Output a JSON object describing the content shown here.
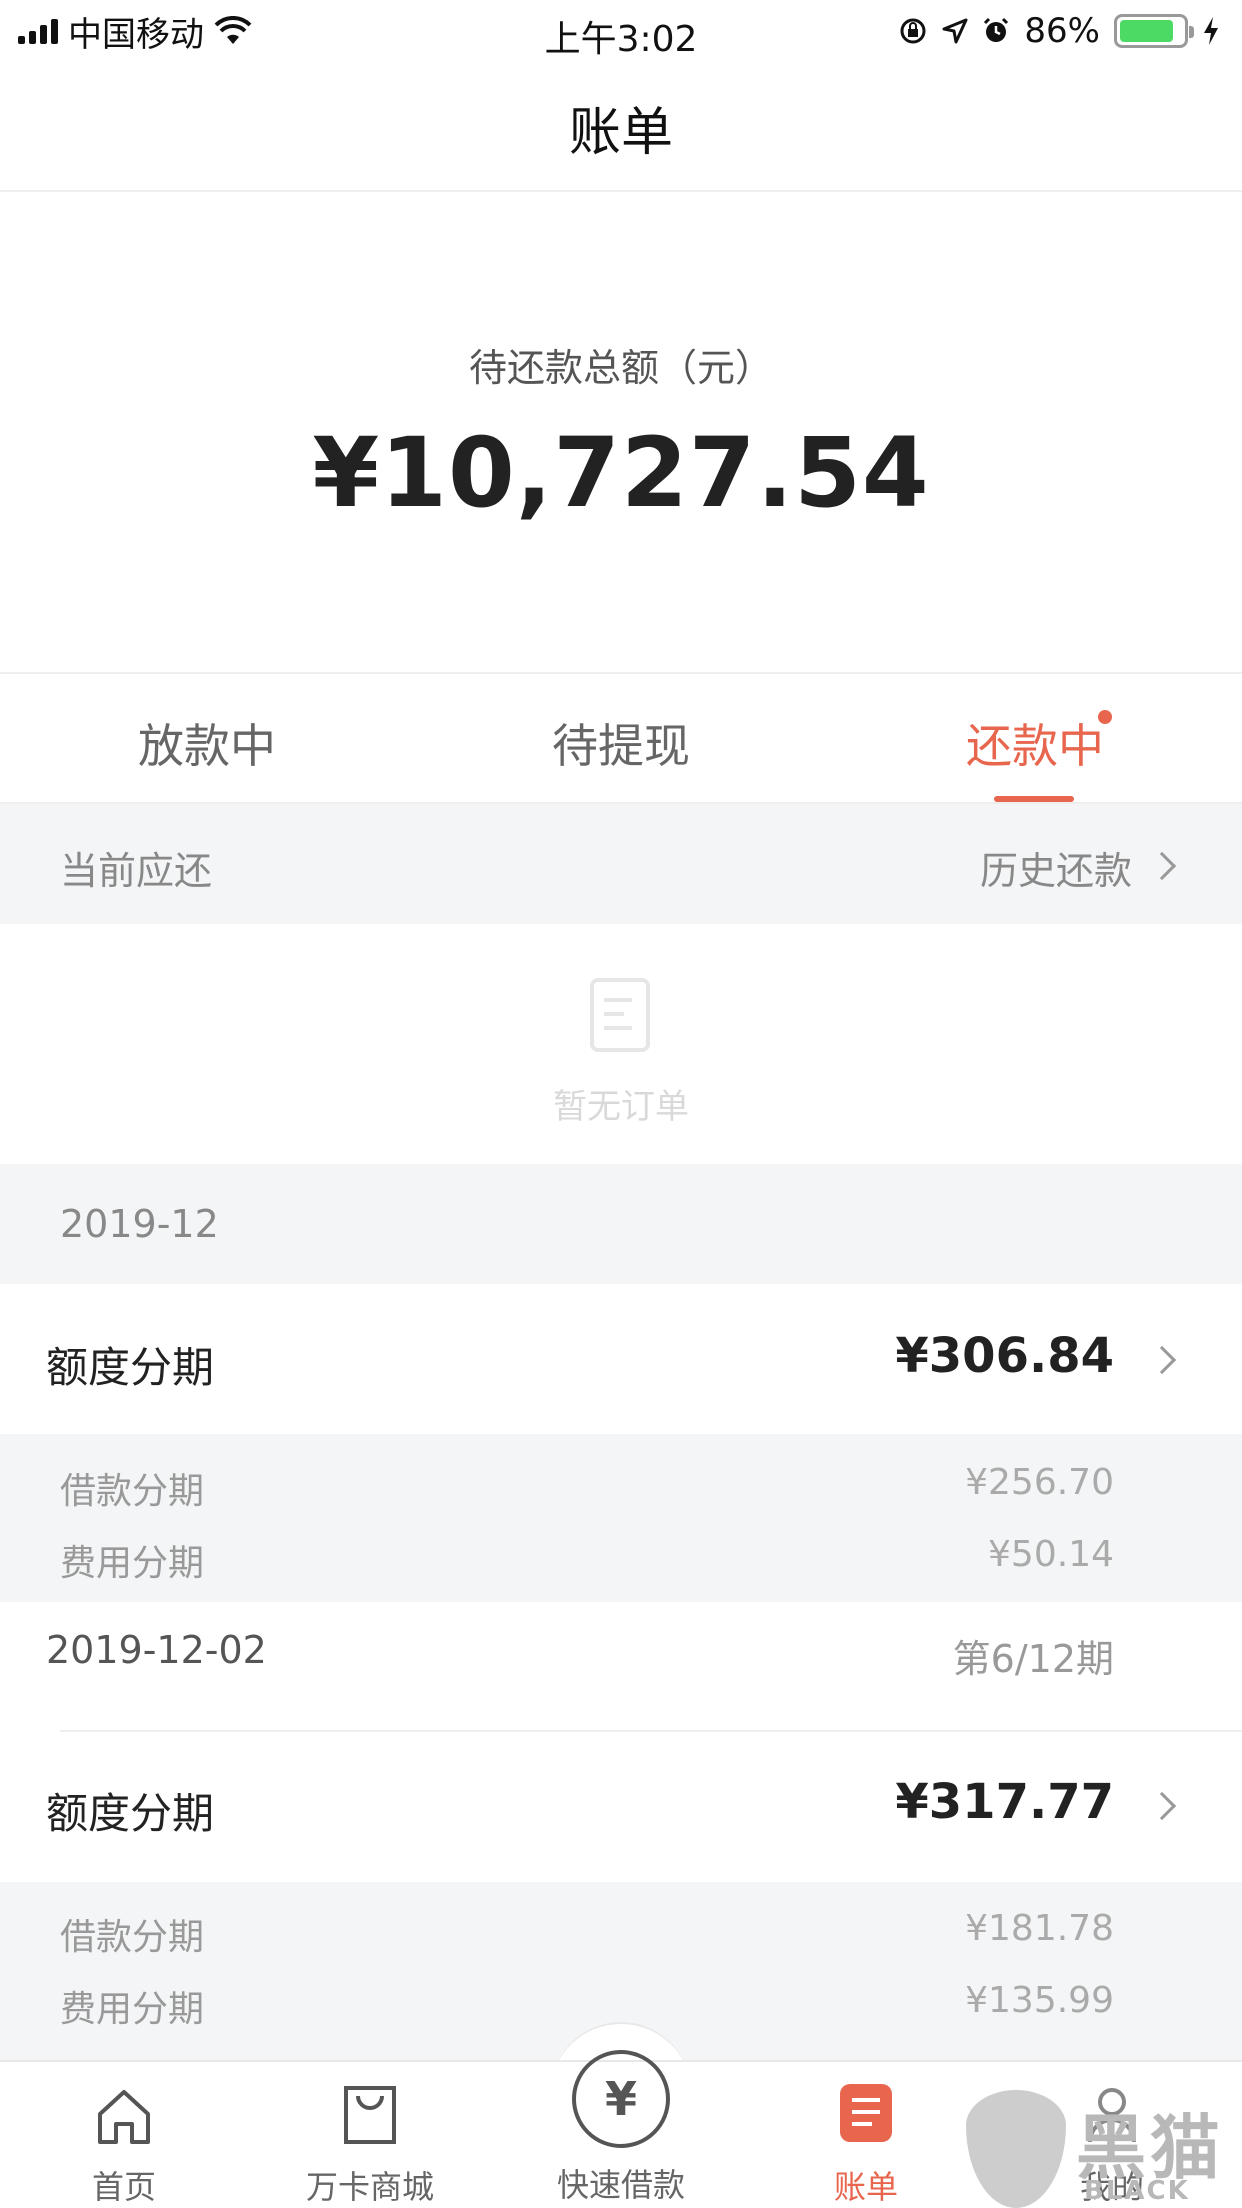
{
  "status_bar": {
    "carrier": "中国移动",
    "time": "上午3:02",
    "battery_percent": "86%",
    "battery_level": 0.86,
    "icons": [
      "signal-icon",
      "wifi-icon",
      "orientation-lock-icon",
      "location-icon",
      "alarm-icon",
      "battery-icon",
      "charging-icon"
    ]
  },
  "nav": {
    "title": "账单"
  },
  "summary": {
    "label": "待还款总额（元）",
    "amount": "¥10,727.54"
  },
  "tabs": [
    {
      "label": "放款中",
      "active": false
    },
    {
      "label": "待提现",
      "active": false
    },
    {
      "label": "还款中",
      "active": true,
      "badge": true
    }
  ],
  "current_bar": {
    "left": "当前应还",
    "right": "历史还款"
  },
  "empty_state": {
    "text": "暂无订单",
    "icon": "document-icon"
  },
  "month_header": "2019-12",
  "bills": [
    {
      "name": "额度分期",
      "amount": "¥306.84",
      "details": [
        {
          "label": "借款分期",
          "value": "¥256.70"
        },
        {
          "label": "费用分期",
          "value": "¥50.14"
        }
      ],
      "date": "2019-12-02",
      "period": "第6/12期"
    },
    {
      "name": "额度分期",
      "amount": "¥317.77",
      "details": [
        {
          "label": "借款分期",
          "value": "¥181.78"
        },
        {
          "label": "费用分期",
          "value": "¥135.99"
        }
      ]
    }
  ],
  "tabbar": {
    "items": [
      {
        "label": "首页",
        "icon": "home-icon",
        "active": false
      },
      {
        "label": "万卡商城",
        "icon": "shopping-bag-icon",
        "active": false
      },
      {
        "label": "快速借款",
        "icon": "yen-icon",
        "active": false,
        "center_glyph": "¥"
      },
      {
        "label": "账单",
        "icon": "bill-icon",
        "active": true
      },
      {
        "label": "我的",
        "icon": "profile-icon",
        "active": false
      }
    ]
  },
  "watermark": {
    "cn": "黑猫",
    "en": "BLACK CAT"
  },
  "colors": {
    "accent": "#e8664e",
    "background_grey": "#f4f5f6"
  }
}
